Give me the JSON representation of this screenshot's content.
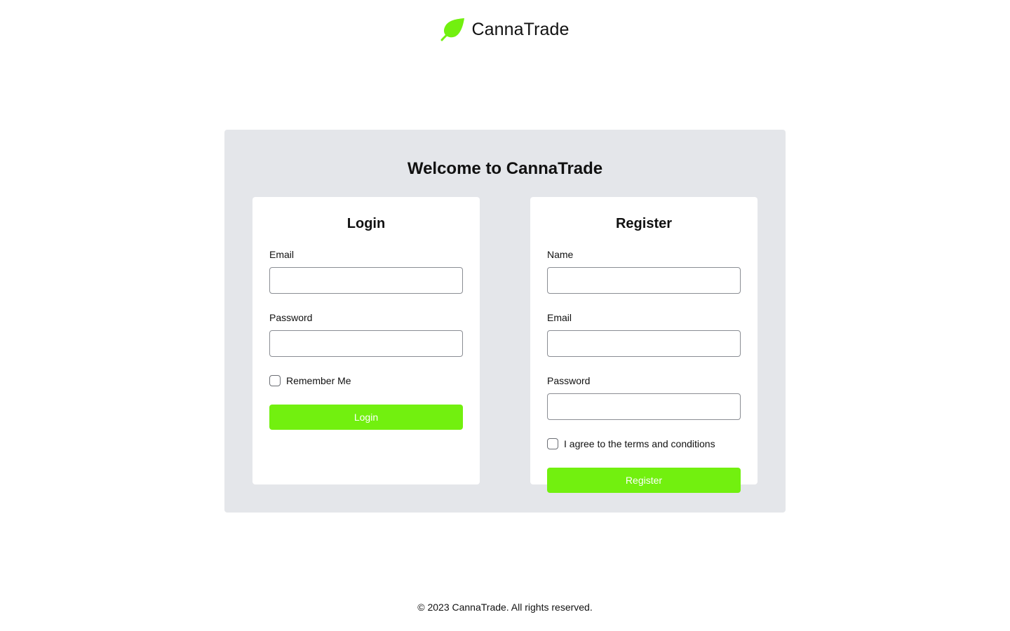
{
  "header": {
    "brand": "CannaTrade",
    "logo_icon": "leaf-icon",
    "accent_color": "#72f00f"
  },
  "main": {
    "title": "Welcome to CannaTrade"
  },
  "login": {
    "title": "Login",
    "email_label": "Email",
    "email_value": "",
    "password_label": "Password",
    "password_value": "",
    "remember_label": "Remember Me",
    "remember_checked": false,
    "button_label": "Login"
  },
  "register": {
    "title": "Register",
    "name_label": "Name",
    "name_value": "",
    "email_label": "Email",
    "email_value": "",
    "password_label": "Password",
    "password_value": "",
    "terms_label": "I agree to the terms and conditions",
    "terms_checked": false,
    "button_label": "Register"
  },
  "footer": {
    "copyright": "© 2023 CannaTrade. All rights reserved."
  }
}
